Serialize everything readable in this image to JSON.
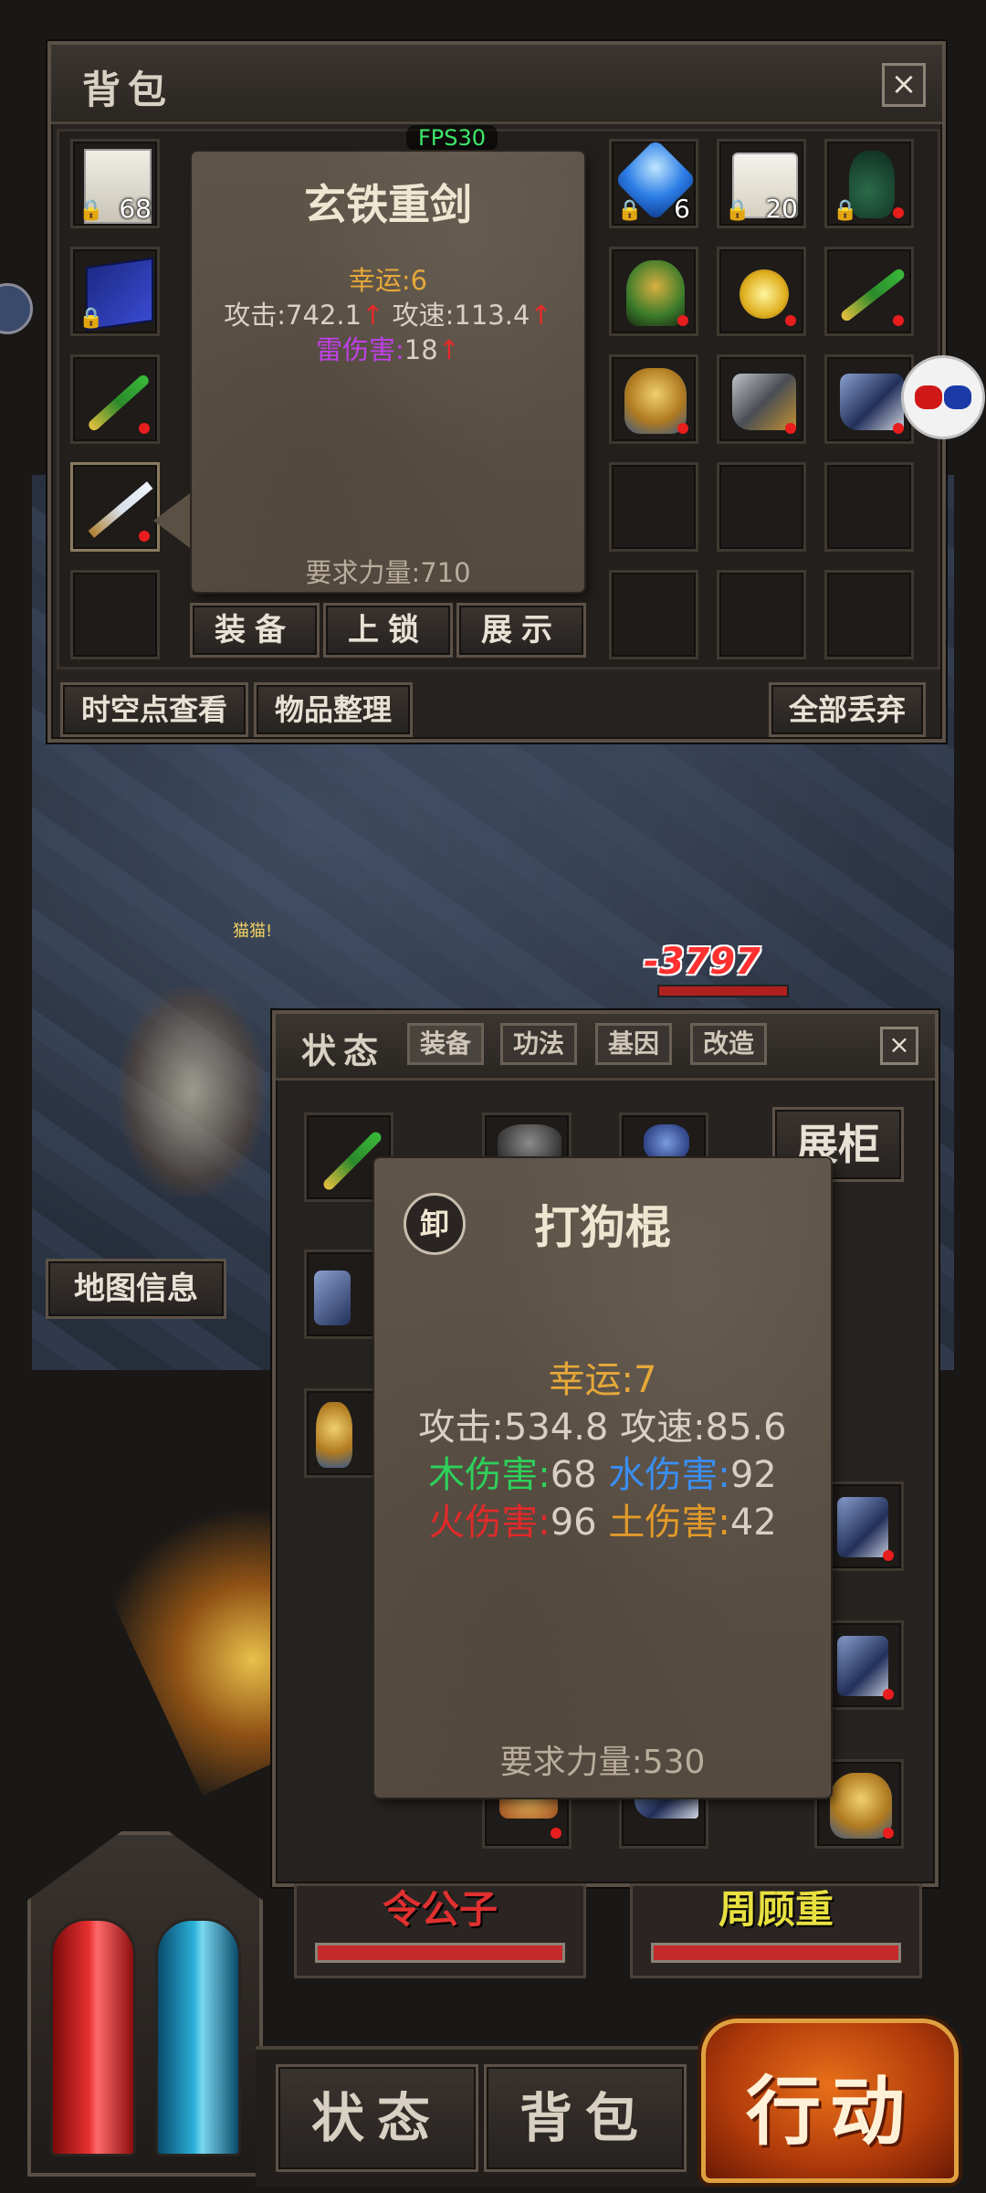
{
  "colors": {
    "lucky": "#e6a83a",
    "red_up": "#e62a2a",
    "thunder": "#c040e8",
    "wood": "#2ecf5a",
    "water": "#3a8ef0",
    "fire": "#e02a2a",
    "earth": "#e39a2a"
  },
  "bag": {
    "title": "背包",
    "close_icon": "×",
    "fps": "FPS30",
    "left_slots": [
      {
        "icon": "book-icon",
        "count": "68"
      },
      {
        "icon": "blue-book-icon",
        "count": ""
      },
      {
        "icon": "green-staff-icon",
        "count": ""
      },
      {
        "icon": "sword-icon",
        "count": ""
      },
      {
        "icon": "empty",
        "count": ""
      }
    ],
    "right_slots": [
      {
        "icon": "blue-gem-icon",
        "count": "6"
      },
      {
        "icon": "bag-food-icon",
        "count": "20"
      },
      {
        "icon": "potion-jar-icon",
        "count": ""
      },
      {
        "icon": "green-helmet-icon",
        "count": ""
      },
      {
        "icon": "gold-amulet-icon",
        "count": ""
      },
      {
        "icon": "green-staff-icon",
        "count": ""
      },
      {
        "icon": "gold-helmet-icon",
        "count": ""
      },
      {
        "icon": "boots-icon",
        "count": ""
      },
      {
        "icon": "blue-boots-icon",
        "count": ""
      }
    ],
    "tooltip": {
      "name": "玄铁重剑",
      "luck": "幸运:6",
      "atk_label": "攻击:742.1",
      "spd_label": "攻速:113.4",
      "arrow": "↑",
      "thunder_label": "雷伤害:",
      "thunder_value": "18",
      "requirement": "要求力量:710"
    },
    "actions": [
      "装备",
      "上锁",
      "展示"
    ],
    "bottom_buttons": {
      "left1": "时空点查看",
      "left2": "物品整理",
      "right": "全部丢弃"
    }
  },
  "world": {
    "damage": "-3797",
    "map_info": "地图信息",
    "name_tag": "猫猫!"
  },
  "status": {
    "title": "状态",
    "tabs": [
      "装备",
      "功法",
      "基因",
      "改造"
    ],
    "close_icon": "×",
    "showcase": "展柜",
    "tooltip": {
      "unequip": "卸",
      "name": "打狗棍",
      "luck": "幸运:7",
      "atk_line": "攻击:534.8 攻速:85.6",
      "wood_label": "木伤害:",
      "wood_value": "68",
      "water_label": "水伤害:",
      "water_value": "92",
      "fire_label": "火伤害:",
      "fire_value": "96",
      "earth_label": "土伤害:",
      "earth_value": "42",
      "requirement": "要求力量:530"
    }
  },
  "party": {
    "left_name": "令公子",
    "right_name": "周顾重"
  },
  "bottom_nav": {
    "status": "状态",
    "bag": "背包",
    "action": "行动"
  }
}
